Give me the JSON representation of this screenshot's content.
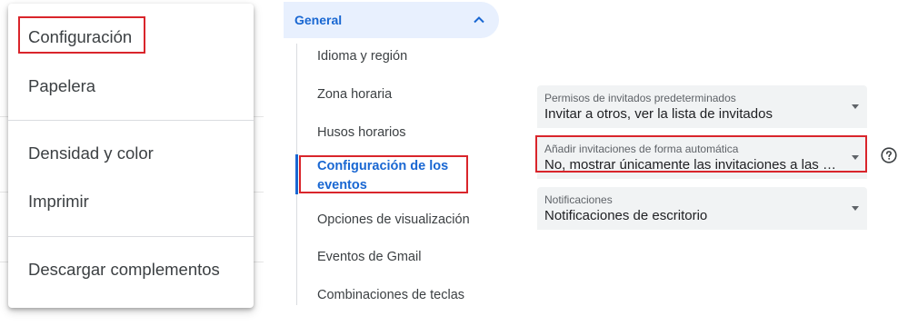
{
  "menu": {
    "items": [
      {
        "label": "Configuración"
      },
      {
        "label": "Papelera"
      },
      {
        "label": "Densidad y color"
      },
      {
        "label": "Imprimir"
      },
      {
        "label": "Descargar complementos"
      }
    ]
  },
  "nav": {
    "section": "General",
    "items": [
      {
        "label": "Idioma y región"
      },
      {
        "label": "Zona horaria"
      },
      {
        "label": "Husos horarios"
      },
      {
        "label": "Configuración de los eventos"
      },
      {
        "label": "Opciones de visualización"
      },
      {
        "label": "Eventos de Gmail"
      },
      {
        "label": "Combinaciones de teclas"
      }
    ]
  },
  "settings": {
    "guest_permissions": {
      "label": "Permisos de invitados predeterminados",
      "value": "Invitar a otros, ver la lista de invitados"
    },
    "auto_invites": {
      "label": "Añadir invitaciones de forma automática",
      "value": "No, mostrar únicamente las invitaciones a las que he respondido"
    },
    "notifications": {
      "label": "Notificaciones",
      "value": "Notificaciones de escritorio"
    }
  },
  "icons": {
    "section_toggle": "chevron-up-icon",
    "help": "help-circle-icon",
    "dropdown": "dropdown-arrow-icon"
  },
  "colors": {
    "accent": "#1967d2",
    "nav_active_bg": "#e8f0fe",
    "highlight": "#d9252b",
    "field_bg": "#f1f3f4"
  }
}
